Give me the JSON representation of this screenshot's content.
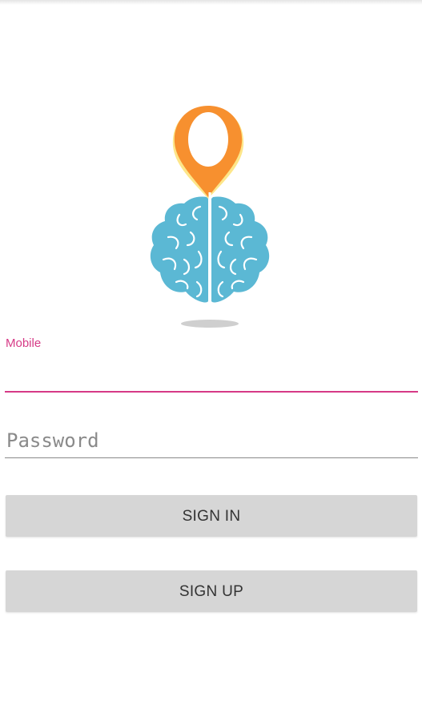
{
  "logo": {
    "icon": "brain-location-pin-icon",
    "colors": {
      "pin": "#f7902f",
      "pin_glow": "#fde68a",
      "brain": "#5bb8d4",
      "shadow": "#cfcfcf"
    }
  },
  "form": {
    "mobile": {
      "label": "Mobile",
      "value": ""
    },
    "password": {
      "placeholder": "Password",
      "value": ""
    }
  },
  "buttons": {
    "sign_in": "SIGN IN",
    "sign_up": "SIGN UP"
  },
  "theme": {
    "accent": "#d63a86",
    "button_bg": "#d6d6d6"
  }
}
